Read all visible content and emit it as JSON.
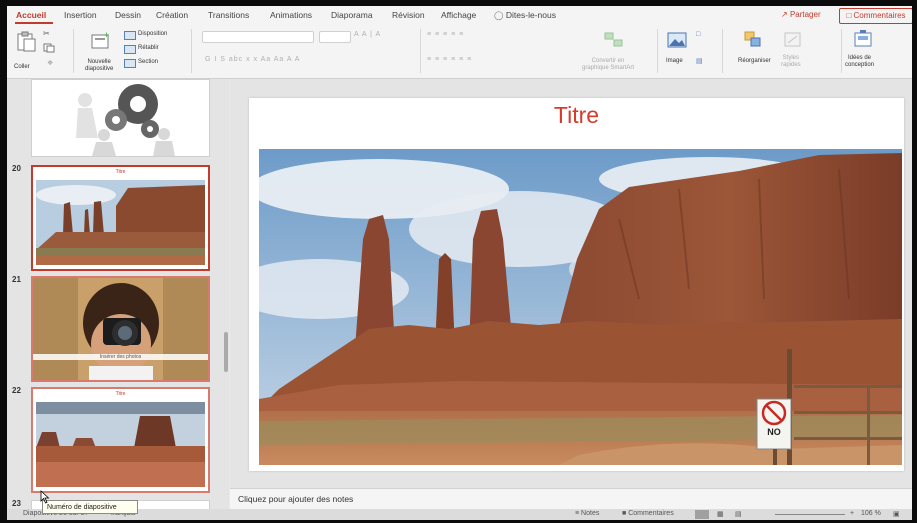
{
  "tabs": [
    "Accueil",
    "Insertion",
    "Dessin",
    "Création",
    "Transitions",
    "Animations",
    "Diaporama",
    "Révision",
    "Affichage"
  ],
  "tell_me": "Dites-le-nous",
  "share_label": "Partager",
  "comments_label": "Commentaires",
  "ribbon": {
    "coller": "Coller",
    "nouvelle_diapositive": "Nouvelle\ndiapositive",
    "disposition": "Disposition",
    "retablir": "Rétablir",
    "section": "Section",
    "convert_smartart": "Convertir en\ngraphique SmartArt",
    "image": "Image",
    "reorganiser": "Réorganiser",
    "styles_rapides": "Styles\nrapides",
    "idees_conception": "Idées de\nconception"
  },
  "thumbnails": [
    {
      "number": "",
      "title": "",
      "caption": ""
    },
    {
      "number": "20",
      "title": "Titre",
      "caption": ""
    },
    {
      "number": "21",
      "title": "",
      "caption": "Insérer des photos"
    },
    {
      "number": "22",
      "title": "Titre",
      "caption": ""
    },
    {
      "number": "23",
      "title": "",
      "caption": ""
    }
  ],
  "slide": {
    "title": "Titre"
  },
  "notes_placeholder": "Cliquez pour ajouter des notes",
  "tooltip": "Numéro de diapositive",
  "status": {
    "slide_info": "Diapositive 20 sur 37",
    "language": "français",
    "notes": "Notes",
    "comments": "Commentaires",
    "zoom": "106 %"
  },
  "sign_text": "NO",
  "colors": {
    "accent": "#c33b2c",
    "title": "#d63b2c"
  }
}
